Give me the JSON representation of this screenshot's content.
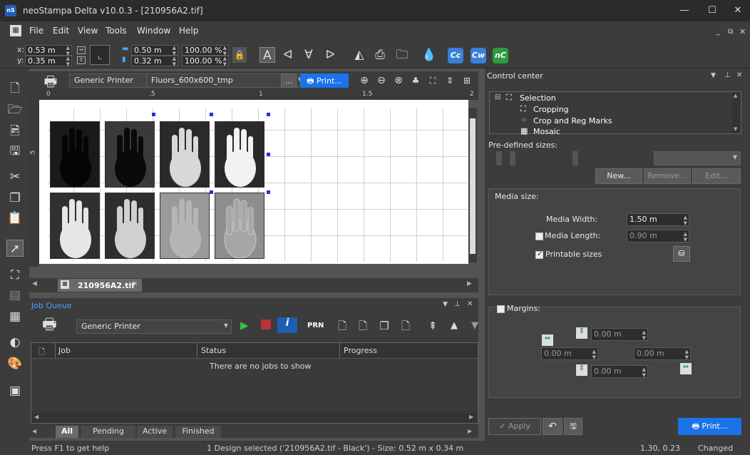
{
  "window": {
    "title": "neoStampa Delta  v10.0.3 - [210956A2.tif]",
    "app_icon": "nS"
  },
  "menu": [
    "File",
    "Edit",
    "View",
    "Tools",
    "Window",
    "Help"
  ],
  "toolbar": {
    "x_label": "x:",
    "x_value": "0.53 m",
    "y_label": "y:",
    "y_value": "0.35 m",
    "w_value": "0.50 m",
    "h_value": "0.32 m",
    "scale_w": "100.00 %",
    "scale_h": "100.00 %",
    "text_tools": [
      "A",
      "ᐊ",
      "∀",
      "ᐅ"
    ],
    "badges": [
      {
        "text": "Cc",
        "color": "#3b7fd6"
      },
      {
        "text": "Cw",
        "color": "#3b7fd6"
      },
      {
        "text": "nC",
        "color": "#2e9a3e"
      }
    ]
  },
  "printer_bar": {
    "printer": "Generic Printer",
    "profile": "Fluors_600x600_tmp",
    "ellipsis": "...",
    "print_label": "Print..."
  },
  "ruler": {
    "h_labels": [
      "0",
      ".5",
      "1",
      "1.5",
      "2"
    ],
    "v_labels": [
      ".5"
    ]
  },
  "document_tab": {
    "name": "210956A2.tif"
  },
  "job_queue": {
    "title": "Job Queue",
    "printer": "Generic Printer",
    "prn_label": "PRN",
    "columns": [
      "Job",
      "Status",
      "Progress"
    ],
    "empty_text": "There are no jobs to show",
    "tabs": [
      "All",
      "Pending",
      "Active",
      "Finished"
    ]
  },
  "control_center": {
    "title": "Control center",
    "tree": [
      "Selection",
      "Cropping",
      "Crop and Reg Marks",
      "Mosaic"
    ],
    "predefined_label": "Pre-defined sizes:",
    "buttons": {
      "new": "New...",
      "remove": "Remove...",
      "edit": "Edit..."
    },
    "media": {
      "group_label": "Media size:",
      "width_label": "Media Width:",
      "width_value": "1.50 m",
      "length_label": "Media Length:",
      "length_value": "0.90 m",
      "printable_label": "Printable sizes"
    },
    "margins": {
      "label": "Margins:",
      "top": "0.00 m",
      "left": "0.00 m",
      "right": "0.00 m",
      "bottom": "0.00 m"
    },
    "apply_label": "Apply",
    "print_label": "Print..."
  },
  "status": {
    "help": "Press F1 to get help",
    "selection": "1 Design selected ('210956A2.tif - Black') - Size: 0.52 m x 0.34 m",
    "coords": "1.30, 0.23",
    "state": "Changed"
  }
}
